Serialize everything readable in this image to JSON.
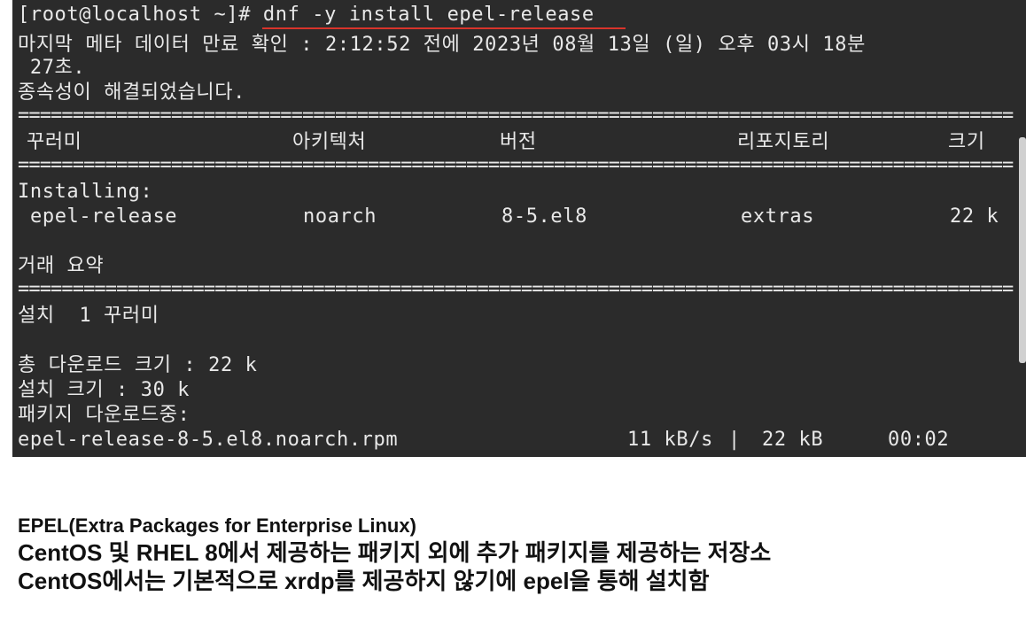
{
  "terminal": {
    "prompt": "[root@localhost ~]# ",
    "command": "dnf -y install epel-release",
    "metadata_line1": "마지막 메타 데이터 만료 확인 : 2:12:52 전에 2023년 08월 13일 (일) 오후 03시 18분",
    "metadata_line2": " 27초.",
    "dependency_resolved": "종속성이 해결되었습니다.",
    "separator": "================================================================================================",
    "headers": {
      "package": "꾸러미",
      "arch": "아키텍처",
      "version": "버전",
      "repository": "리포지토리",
      "size": "크기"
    },
    "installing_label": "Installing:",
    "package_row": {
      "name": "epel-release",
      "arch": "noarch",
      "version": "8-5.el8",
      "repository": "extras",
      "size": "22 k"
    },
    "transaction_summary": "거래 요약",
    "install_count": "설치  1 꾸러미",
    "total_download": "총 다운로드 크기 : 22 k",
    "install_size": "설치 크기 : 30 k",
    "downloading": "패키지 다운로드중:",
    "download_file": "epel-release-8-5.el8.noarch.rpm",
    "download_speed": "11 kB/s",
    "download_sep": "|",
    "download_size": "22 kB",
    "download_time": "00:02"
  },
  "notes": {
    "line1": "EPEL(Extra  Packages for Enterprise Linux)",
    "line2": "CentOS 및 RHEL 8에서 제공하는 패키지 외에 추가 패키지를 제공하는 저장소",
    "line3": "CentOS에서는 기본적으로 xrdp를 제공하지 않기에 epel을 통해 설치함"
  },
  "colors": {
    "terminal_bg": "#2b2b2b",
    "terminal_text": "#e8e8e8",
    "underline": "#d9342b"
  }
}
